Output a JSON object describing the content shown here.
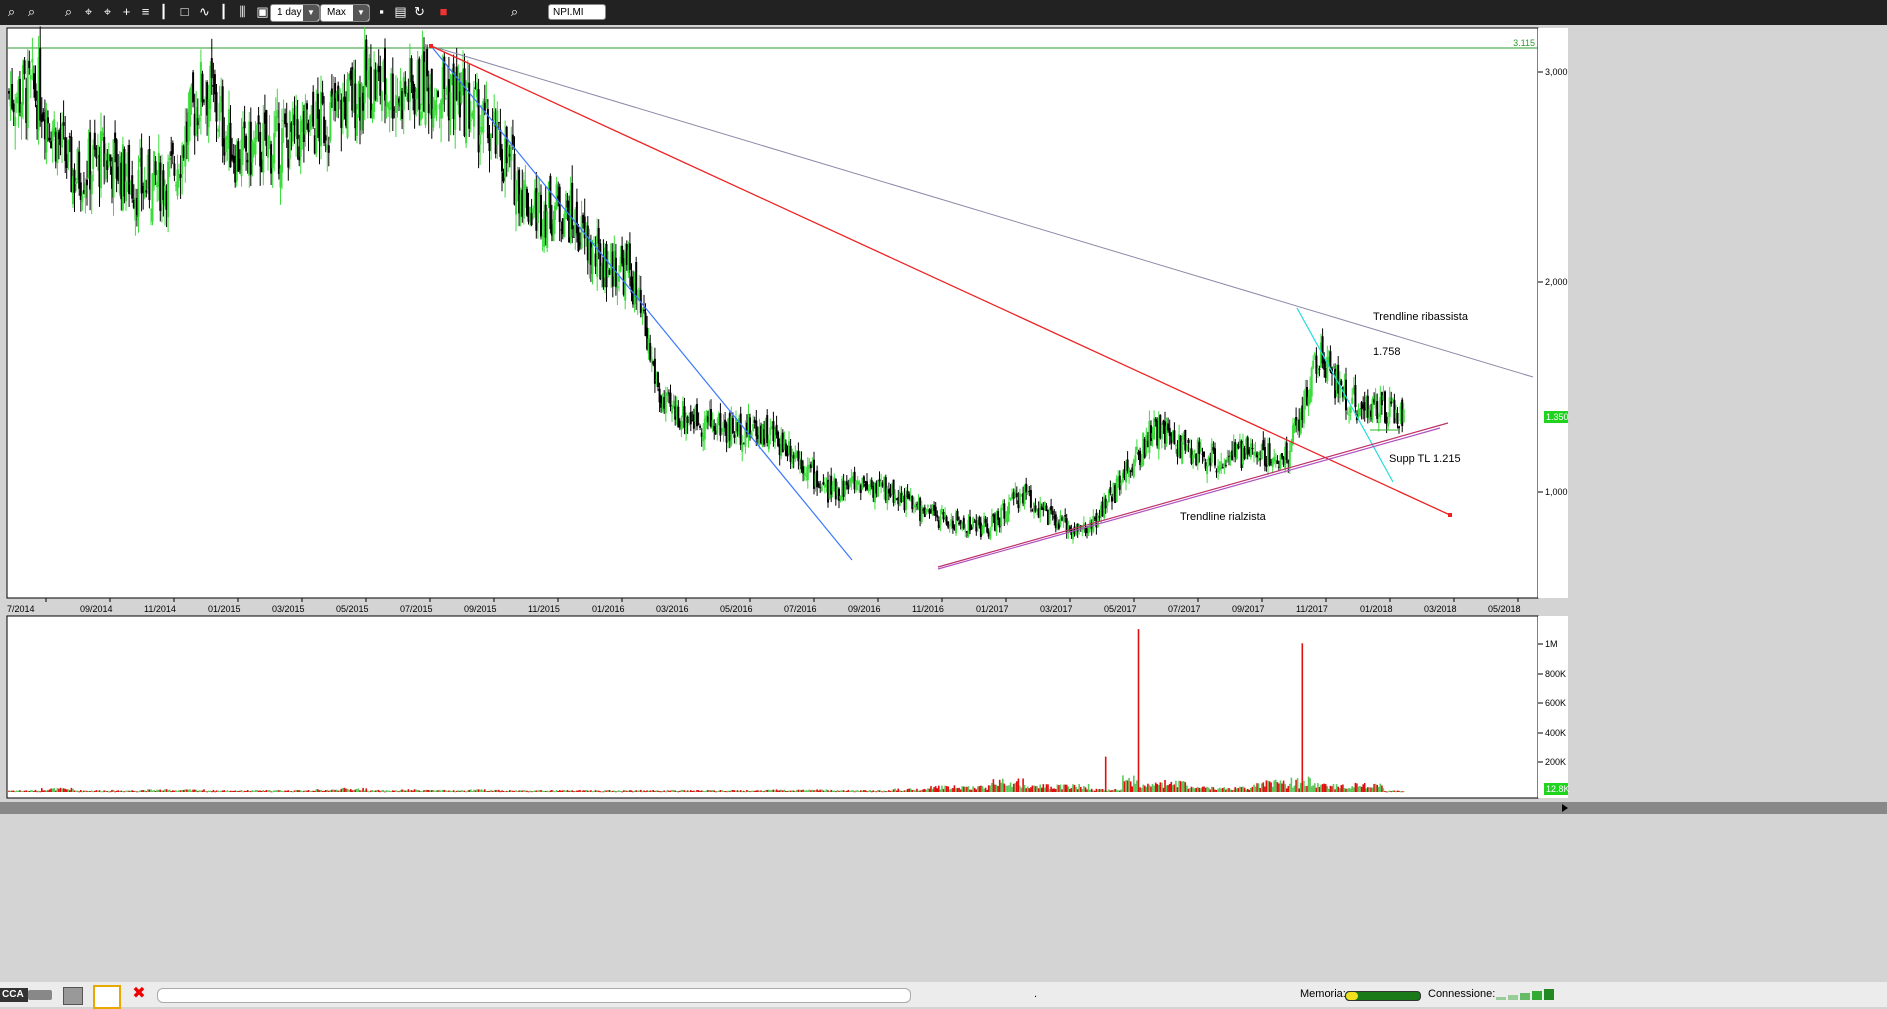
{
  "toolbar": {
    "interval": "1 day",
    "range": "Max",
    "symbol": "NPI.MI"
  },
  "price_axis": {
    "ticks": [
      "3,000",
      "2,000",
      "1,000"
    ],
    "reference_level": "3.115",
    "last_price": "1.350"
  },
  "volume_axis": {
    "ticks": [
      "1M",
      "800K",
      "600K",
      "400K",
      "200K"
    ],
    "last_volume": "12.8K"
  },
  "time_axis": {
    "labels": [
      "7/2014",
      "09/2014",
      "11/2014",
      "01/2015",
      "03/2015",
      "05/2015",
      "07/2015",
      "09/2015",
      "11/2015",
      "01/2016",
      "03/2016",
      "05/2016",
      "07/2016",
      "09/2016",
      "11/2016",
      "01/2017",
      "03/2017",
      "05/2017",
      "07/2017",
      "09/2017",
      "11/2017",
      "01/2018",
      "03/2018",
      "05/2018"
    ]
  },
  "annotations": {
    "trend_down": "Trendline ribassista",
    "level": "1.758",
    "supp": "Supp TL 1.215",
    "trend_up": "Trendline rialzista"
  },
  "statusbar": {
    "tab": "CCA",
    "memory_label": "Memoria:",
    "connection_label": "Connessione:",
    "dot": "."
  },
  "colors": {
    "up": "#3cdc3c",
    "down": "#000000",
    "vol_up": "#5cc85c",
    "vol_down": "#e01010",
    "tl_blue": "#3a78ff",
    "tl_red": "#ee2222",
    "tl_grey": "#8a8aa8",
    "tl_cyan": "#22dddd",
    "tl_magenta": "#c0306a",
    "ref_line": "#2c9a2c"
  },
  "chart_data": [
    {
      "type": "candlestick",
      "symbol": "NPI.MI",
      "interval": "1 day",
      "x": [
        "07/2014",
        "08/2014",
        "09/2014",
        "10/2014",
        "11/2014",
        "12/2014",
        "01/2015",
        "02/2015",
        "03/2015",
        "04/2015",
        "05/2015",
        "06/2015",
        "07/2015",
        "08/2015",
        "09/2015",
        "10/2015",
        "11/2015",
        "12/2015",
        "01/2016",
        "02/2016",
        "03/2016",
        "04/2016",
        "05/2016",
        "06/2016",
        "07/2016",
        "08/2016",
        "09/2016",
        "10/2016",
        "11/2016",
        "12/2016",
        "01/2017",
        "02/2017",
        "03/2017",
        "04/2017",
        "05/2017",
        "06/2017",
        "07/2017",
        "08/2017",
        "09/2017",
        "10/2017",
        "11/2017",
        "12/2017",
        "01/2018"
      ],
      "close": [
        2.9,
        2.5,
        2.6,
        2.45,
        2.5,
        2.95,
        2.6,
        2.65,
        2.7,
        2.8,
        2.95,
        2.9,
        2.95,
        2.85,
        2.65,
        2.35,
        2.35,
        2.1,
        2.05,
        1.4,
        1.35,
        1.3,
        1.3,
        1.2,
        1.0,
        1.05,
        1.0,
        0.9,
        0.85,
        0.83,
        1.0,
        0.85,
        0.82,
        1.05,
        1.3,
        1.2,
        1.15,
        1.2,
        1.15,
        1.65,
        1.42,
        1.38,
        1.35
      ],
      "ylim": [
        0.7,
        3.3
      ],
      "reference_level": 3.115,
      "last_price": 1.35
    },
    {
      "type": "bar",
      "series": [
        {
          "name": "Volume",
          "values": [
            15000,
            30000,
            15000,
            15000,
            20000,
            20000,
            15000,
            15000,
            15000,
            20000,
            30000,
            15000,
            20000,
            15000,
            20000,
            15000,
            15000,
            15000,
            15000,
            15000,
            15000,
            15000,
            15000,
            20000,
            20000,
            15000,
            15000,
            25000,
            50000,
            50000,
            100000,
            60000,
            60000,
            250000,
            1150000,
            90000,
            40000,
            40000,
            90000,
            1050000,
            60000,
            70000,
            12800
          ]
        }
      ],
      "ylim": [
        0,
        1200000
      ],
      "last_volume": 12800
    }
  ]
}
